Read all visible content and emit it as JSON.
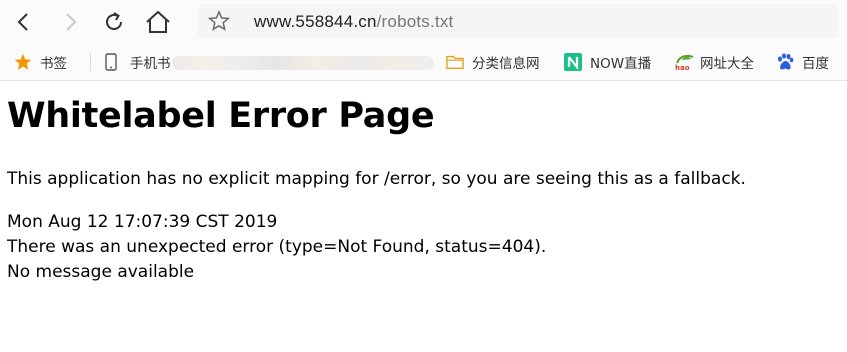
{
  "browser": {
    "address_bar": {
      "domain": "www.558844.cn",
      "path": "/robots.txt"
    },
    "bookmarks": [
      {
        "label": "书签",
        "icon": "star-icon"
      },
      {
        "label": "手机书",
        "icon": "phone-icon"
      },
      {
        "label": "分类信息网",
        "icon": "folder-icon"
      },
      {
        "label": "NOW直播",
        "icon": "now-live-icon"
      },
      {
        "label": "网址大全",
        "icon": "hao-icon"
      },
      {
        "label": "百度",
        "icon": "baidu-paw-icon"
      }
    ],
    "colors": {
      "bookmark_star": "#f39800",
      "now_live": "#19c08a",
      "folder": "#f2b93b",
      "baidu": "#2b5fd9",
      "hao": "#5aa02c"
    }
  },
  "page": {
    "title": "Whitelabel Error Page",
    "description": "This application has no explicit mapping for /error, so you are seeing this as a fallback.",
    "timestamp": "Mon Aug 12 17:07:39 CST 2019",
    "error_line": "There was an unexpected error (type=Not Found, status=404).",
    "message": "No message available"
  }
}
